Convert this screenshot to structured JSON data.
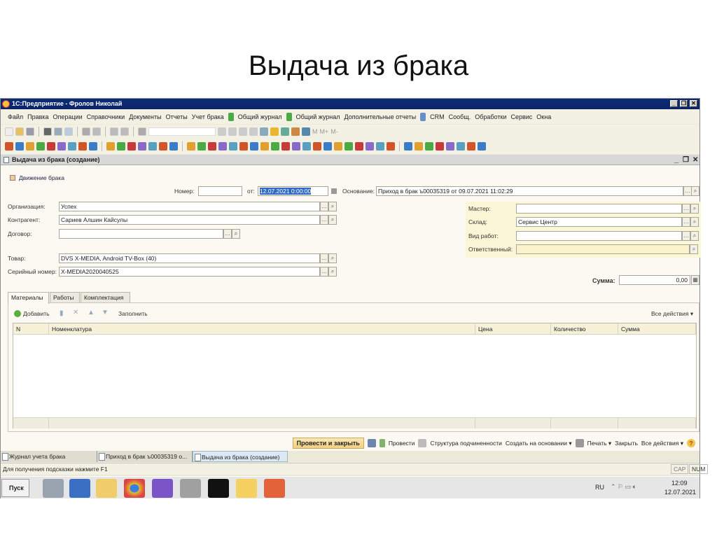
{
  "slide_title": "Выдача из брака",
  "app": {
    "title": "1С:Предприятие - Фролов Николай"
  },
  "menu": [
    "Файл",
    "Правка",
    "Операции",
    "Справочники",
    "Документы",
    "Отчеты",
    "Учет брака",
    "Общий журнал",
    "Общий журнал",
    "Дополнительные отчеты",
    "CRM",
    "Сообщ.",
    "Обработки",
    "Сервис",
    "Окна"
  ],
  "toolbar1_icons": [
    "new-icon",
    "open-icon",
    "save-icon",
    "cut-icon",
    "copy-icon",
    "paste-icon",
    "print-icon",
    "preview-icon",
    "back-icon",
    "forward-icon",
    "search-icon"
  ],
  "toolbar1_memory": [
    "M",
    "M+",
    "M-"
  ],
  "toolbar2_count": 44,
  "doc": {
    "title": "Выдача из брака (создание)",
    "movement_link": "Движение брака"
  },
  "form": {
    "number_label": "Номер:",
    "number_value": "",
    "date_label": "от:",
    "date_value": "12.07.2021  0:00:00",
    "basis_label": "Основание:",
    "basis_value": "Приход в брак ъ00035319 от 09.07.2021 11:02:29",
    "org_label": "Организация:",
    "org_value": "Успех",
    "contractor_label": "Контрагент:",
    "contractor_value": "Сариев Алшин Кайсулы",
    "contract_label": "Договор:",
    "contract_value": "",
    "product_label": "Товар:",
    "product_value": "DVS X-MEDIA,  Android TV-Box (40)",
    "serial_label": "Серийный номер:",
    "serial_value": "X-MEDIA2020040525",
    "master_label": "Мастер:",
    "master_value": "",
    "warehouse_label": "Склад:",
    "warehouse_value": "Сервис Центр",
    "worktype_label": "Вид работ:",
    "worktype_value": "",
    "responsible_label": "Ответственный:",
    "responsible_value": "",
    "sum_label": "Сумма:",
    "sum_value": "0,00"
  },
  "tabs": [
    "Материалы",
    "Работы",
    "Комплектация"
  ],
  "table_toolbar": {
    "add": "Добавить",
    "fill": "Заполнить",
    "all_actions": "Все действия ▾"
  },
  "columns": [
    "N",
    "Номенклатура",
    "Цена",
    "Количество",
    "Сумма"
  ],
  "actions": {
    "post_close": "Провести и закрыть",
    "post": "Провести",
    "structure": "Структура подчиненности",
    "create_based": "Создать на основании ▾",
    "print": "Печать ▾",
    "close": "Закрыть",
    "all_actions": "Все действия ▾",
    "help": "?"
  },
  "window_tabs": [
    "Журнал учета брака",
    "Приход в брак ъ00035319 о...",
    "Выдача из брака (создание)"
  ],
  "status": {
    "hint": "Для получения подсказки нажмите F1",
    "cap": "CAP",
    "num": "NUM"
  },
  "taskbar": {
    "start": "Пуск",
    "lang": "RU",
    "time": "12:09",
    "date": "12.07.2021"
  }
}
